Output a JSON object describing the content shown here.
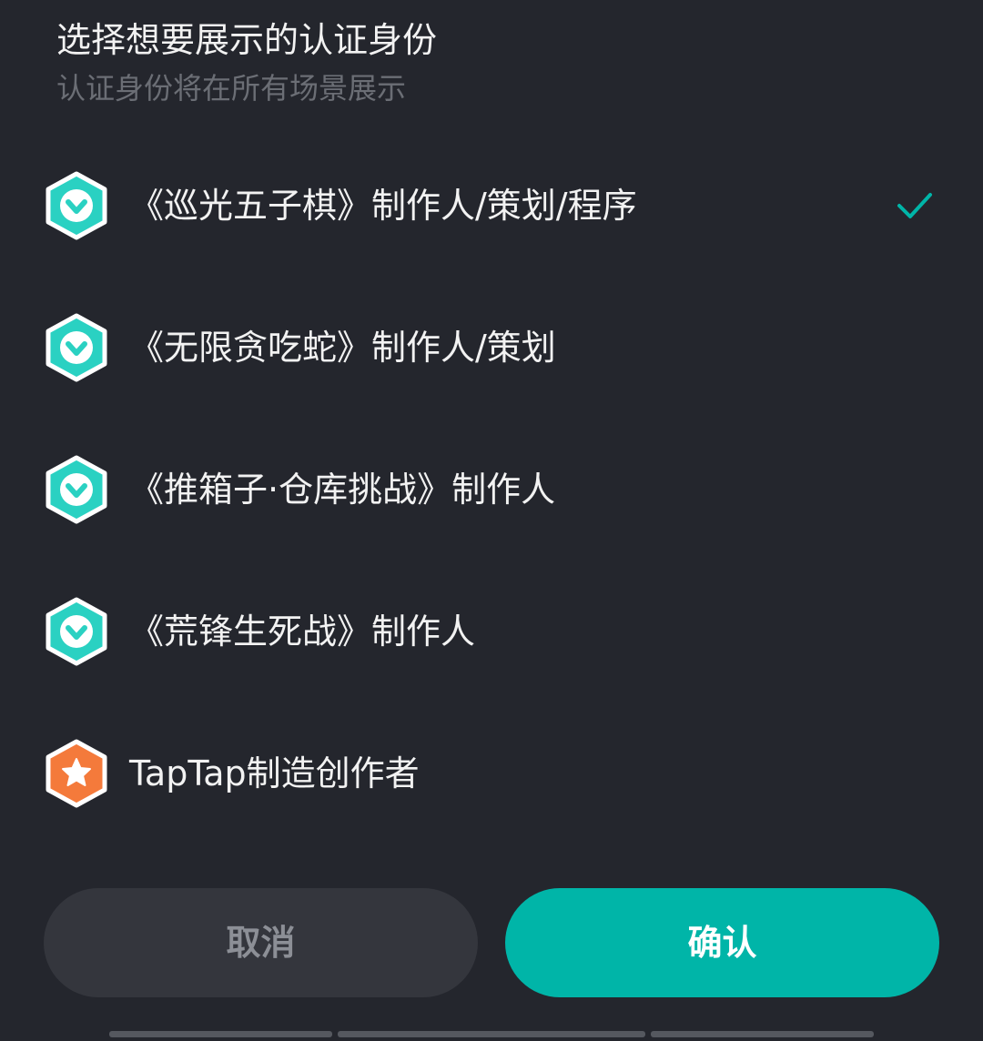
{
  "dialog": {
    "title": "选择想要展示的认证身份",
    "subtitle": "认证身份将在所有场景展示"
  },
  "identities": [
    {
      "label": "《巡光五子棋》制作人/策划/程序",
      "icon": "verified-developer-icon",
      "selected": true
    },
    {
      "label": "《无限贪吃蛇》制作人/策划",
      "icon": "verified-developer-icon",
      "selected": false
    },
    {
      "label": "《推箱子·仓库挑战》制作人",
      "icon": "verified-developer-icon",
      "selected": false
    },
    {
      "label": "《荒锋生死战》制作人",
      "icon": "verified-developer-icon",
      "selected": false
    },
    {
      "label": "TapTap制造创作者",
      "icon": "star-creator-icon",
      "selected": false
    }
  ],
  "buttons": {
    "cancel": "取消",
    "confirm": "确认"
  },
  "colors": {
    "background": "#24262d",
    "accent": "#00b5a8",
    "teal_badge": "#2ad1c2",
    "orange_badge": "#f47a3b"
  }
}
